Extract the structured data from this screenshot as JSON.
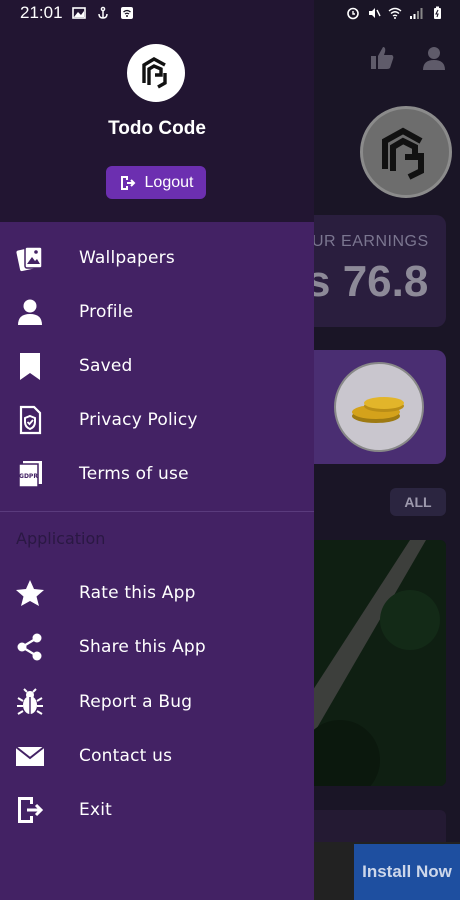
{
  "status_bar": {
    "time": "21:01"
  },
  "drawer": {
    "brand": "Todo Code",
    "logout_label": "Logout",
    "items": [
      {
        "label": "Wallpapers",
        "icon": "wallpapers-icon"
      },
      {
        "label": "Profile",
        "icon": "profile-icon"
      },
      {
        "label": "Saved",
        "icon": "bookmark-icon"
      },
      {
        "label": "Privacy Policy",
        "icon": "privacy-policy-icon"
      },
      {
        "label": "Terms of use",
        "icon": "gdpr-document-icon"
      }
    ],
    "section_title": "Application",
    "app_items": [
      {
        "label": "Rate this App",
        "icon": "star-icon"
      },
      {
        "label": "Share this App",
        "icon": "share-icon"
      },
      {
        "label": "Report a Bug",
        "icon": "bug-icon"
      },
      {
        "label": "Contact us",
        "icon": "mail-icon"
      },
      {
        "label": "Exit",
        "icon": "exit-icon"
      }
    ]
  },
  "background": {
    "earnings_label": "UR EARNINGS",
    "earnings_value": "s 76.8",
    "all_button": "ALL",
    "ad_button": "Install Now"
  },
  "colors": {
    "drawer_bg": "#432264",
    "header_bg": "#221532",
    "accent": "#6c2fb0"
  }
}
